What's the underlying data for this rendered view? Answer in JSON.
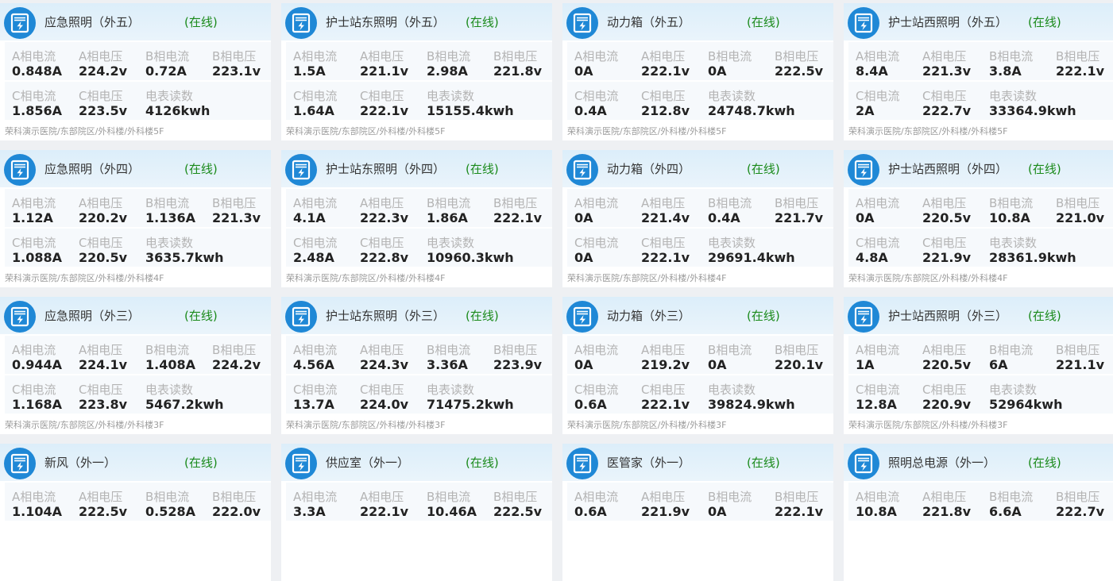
{
  "status_color": "#1a8a1a",
  "icon_color": "#1f88d6",
  "labels": {
    "a_current": "A相电流",
    "a_voltage": "A相电压",
    "b_current": "B相电流",
    "b_voltage": "B相电压",
    "c_current": "C相电流",
    "c_voltage": "C相电压",
    "meter": "电表读数"
  },
  "cards": [
    {
      "name": "应急照明（外五）",
      "status": "(在线)",
      "a_current": "0.848A",
      "a_voltage": "224.2v",
      "b_current": "0.72A",
      "b_voltage": "223.1v",
      "c_current": "1.856A",
      "c_voltage": "223.5v",
      "meter": "4126kwh",
      "location": "荣科演示医院/东部院区/外科楼/外科楼5F"
    },
    {
      "name": "护士站东照明（外五）",
      "status": "(在线)",
      "a_current": "1.5A",
      "a_voltage": "221.1v",
      "b_current": "2.98A",
      "b_voltage": "221.8v",
      "c_current": "1.64A",
      "c_voltage": "222.1v",
      "meter": "15155.4kwh",
      "location": "荣科演示医院/东部院区/外科楼/外科楼5F"
    },
    {
      "name": "动力箱（外五）",
      "status": "(在线)",
      "a_current": "0A",
      "a_voltage": "222.1v",
      "b_current": "0A",
      "b_voltage": "222.5v",
      "c_current": "0.4A",
      "c_voltage": "212.8v",
      "meter": "24748.7kwh",
      "location": "荣科演示医院/东部院区/外科楼/外科楼5F"
    },
    {
      "name": "护士站西照明（外五）",
      "status": "(在线)",
      "a_current": "8.4A",
      "a_voltage": "221.3v",
      "b_current": "3.8A",
      "b_voltage": "222.1v",
      "c_current": "2A",
      "c_voltage": "222.7v",
      "meter": "33364.9kwh",
      "location": "荣科演示医院/东部院区/外科楼/外科楼5F"
    },
    {
      "name": "应急照明（外四）",
      "status": "(在线)",
      "a_current": "1.12A",
      "a_voltage": "220.2v",
      "b_current": "1.136A",
      "b_voltage": "221.3v",
      "c_current": "1.088A",
      "c_voltage": "220.5v",
      "meter": "3635.7kwh",
      "location": "荣科演示医院/东部院区/外科楼/外科楼4F"
    },
    {
      "name": "护士站东照明（外四）",
      "status": "(在线)",
      "a_current": "4.1A",
      "a_voltage": "222.3v",
      "b_current": "1.86A",
      "b_voltage": "222.1v",
      "c_current": "2.48A",
      "c_voltage": "222.8v",
      "meter": "10960.3kwh",
      "location": "荣科演示医院/东部院区/外科楼/外科楼4F"
    },
    {
      "name": "动力箱（外四）",
      "status": "(在线)",
      "a_current": "0A",
      "a_voltage": "221.4v",
      "b_current": "0.4A",
      "b_voltage": "221.7v",
      "c_current": "0A",
      "c_voltage": "222.1v",
      "meter": "29691.4kwh",
      "location": "荣科演示医院/东部院区/外科楼/外科楼4F"
    },
    {
      "name": "护士站西照明（外四）",
      "status": "(在线)",
      "a_current": "0A",
      "a_voltage": "220.5v",
      "b_current": "10.8A",
      "b_voltage": "221.0v",
      "c_current": "4.8A",
      "c_voltage": "221.9v",
      "meter": "28361.9kwh",
      "location": "荣科演示医院/东部院区/外科楼/外科楼4F"
    },
    {
      "name": "应急照明（外三）",
      "status": "(在线)",
      "a_current": "0.944A",
      "a_voltage": "224.1v",
      "b_current": "1.408A",
      "b_voltage": "224.2v",
      "c_current": "1.168A",
      "c_voltage": "223.8v",
      "meter": "5467.2kwh",
      "location": "荣科演示医院/东部院区/外科楼/外科楼3F"
    },
    {
      "name": "护士站东照明（外三）",
      "status": "(在线)",
      "a_current": "4.56A",
      "a_voltage": "224.3v",
      "b_current": "3.36A",
      "b_voltage": "223.9v",
      "c_current": "13.7A",
      "c_voltage": "224.0v",
      "meter": "71475.2kwh",
      "location": "荣科演示医院/东部院区/外科楼/外科楼3F"
    },
    {
      "name": "动力箱（外三）",
      "status": "(在线)",
      "a_current": "0A",
      "a_voltage": "219.2v",
      "b_current": "0A",
      "b_voltage": "220.1v",
      "c_current": "0.6A",
      "c_voltage": "222.1v",
      "meter": "39824.9kwh",
      "location": "荣科演示医院/东部院区/外科楼/外科楼3F"
    },
    {
      "name": "护士站西照明（外三）",
      "status": "(在线)",
      "a_current": "1A",
      "a_voltage": "220.5v",
      "b_current": "6A",
      "b_voltage": "221.1v",
      "c_current": "12.8A",
      "c_voltage": "220.9v",
      "meter": "52964kwh",
      "location": "荣科演示医院/东部院区/外科楼/外科楼3F"
    },
    {
      "name": "新风（外一）",
      "status": "(在线)",
      "a_current": "1.104A",
      "a_voltage": "222.5v",
      "b_current": "0.528A",
      "b_voltage": "222.0v"
    },
    {
      "name": "供应室（外一）",
      "status": "(在线)",
      "a_current": "3.3A",
      "a_voltage": "222.1v",
      "b_current": "10.46A",
      "b_voltage": "222.5v"
    },
    {
      "name": "医管家（外一）",
      "status": "(在线)",
      "a_current": "0.6A",
      "a_voltage": "221.9v",
      "b_current": "0A",
      "b_voltage": "222.1v"
    },
    {
      "name": "照明总电源（外一）",
      "status": "(在线)",
      "a_current": "10.8A",
      "a_voltage": "221.8v",
      "b_current": "6.6A",
      "b_voltage": "222.7v"
    }
  ]
}
